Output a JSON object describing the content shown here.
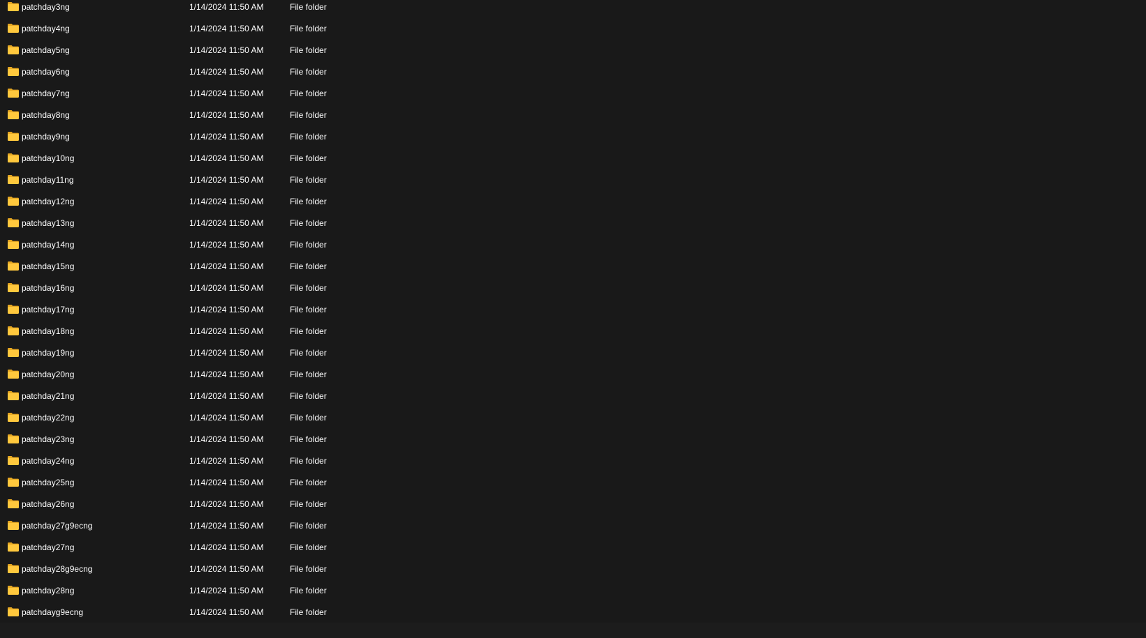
{
  "theme": {
    "background": "#191919",
    "text": "#ffffff",
    "folder_icon_color": "#ffc83d",
    "folder_icon_shade": "#e6a823"
  },
  "rows": [
    {
      "name": "patchday3ng",
      "date": "1/14/2024 11:50 AM",
      "type": "File folder",
      "icon": "folder-icon"
    },
    {
      "name": "patchday4ng",
      "date": "1/14/2024 11:50 AM",
      "type": "File folder",
      "icon": "folder-icon"
    },
    {
      "name": "patchday5ng",
      "date": "1/14/2024 11:50 AM",
      "type": "File folder",
      "icon": "folder-icon"
    },
    {
      "name": "patchday6ng",
      "date": "1/14/2024 11:50 AM",
      "type": "File folder",
      "icon": "folder-icon"
    },
    {
      "name": "patchday7ng",
      "date": "1/14/2024 11:50 AM",
      "type": "File folder",
      "icon": "folder-icon"
    },
    {
      "name": "patchday8ng",
      "date": "1/14/2024 11:50 AM",
      "type": "File folder",
      "icon": "folder-icon"
    },
    {
      "name": "patchday9ng",
      "date": "1/14/2024 11:50 AM",
      "type": "File folder",
      "icon": "folder-icon"
    },
    {
      "name": "patchday10ng",
      "date": "1/14/2024 11:50 AM",
      "type": "File folder",
      "icon": "folder-icon"
    },
    {
      "name": "patchday11ng",
      "date": "1/14/2024 11:50 AM",
      "type": "File folder",
      "icon": "folder-icon"
    },
    {
      "name": "patchday12ng",
      "date": "1/14/2024 11:50 AM",
      "type": "File folder",
      "icon": "folder-icon"
    },
    {
      "name": "patchday13ng",
      "date": "1/14/2024 11:50 AM",
      "type": "File folder",
      "icon": "folder-icon"
    },
    {
      "name": "patchday14ng",
      "date": "1/14/2024 11:50 AM",
      "type": "File folder",
      "icon": "folder-icon"
    },
    {
      "name": "patchday15ng",
      "date": "1/14/2024 11:50 AM",
      "type": "File folder",
      "icon": "folder-icon"
    },
    {
      "name": "patchday16ng",
      "date": "1/14/2024 11:50 AM",
      "type": "File folder",
      "icon": "folder-icon"
    },
    {
      "name": "patchday17ng",
      "date": "1/14/2024 11:50 AM",
      "type": "File folder",
      "icon": "folder-icon"
    },
    {
      "name": "patchday18ng",
      "date": "1/14/2024 11:50 AM",
      "type": "File folder",
      "icon": "folder-icon"
    },
    {
      "name": "patchday19ng",
      "date": "1/14/2024 11:50 AM",
      "type": "File folder",
      "icon": "folder-icon"
    },
    {
      "name": "patchday20ng",
      "date": "1/14/2024 11:50 AM",
      "type": "File folder",
      "icon": "folder-icon"
    },
    {
      "name": "patchday21ng",
      "date": "1/14/2024 11:50 AM",
      "type": "File folder",
      "icon": "folder-icon"
    },
    {
      "name": "patchday22ng",
      "date": "1/14/2024 11:50 AM",
      "type": "File folder",
      "icon": "folder-icon"
    },
    {
      "name": "patchday23ng",
      "date": "1/14/2024 11:50 AM",
      "type": "File folder",
      "icon": "folder-icon"
    },
    {
      "name": "patchday24ng",
      "date": "1/14/2024 11:50 AM",
      "type": "File folder",
      "icon": "folder-icon"
    },
    {
      "name": "patchday25ng",
      "date": "1/14/2024 11:50 AM",
      "type": "File folder",
      "icon": "folder-icon"
    },
    {
      "name": "patchday26ng",
      "date": "1/14/2024 11:50 AM",
      "type": "File folder",
      "icon": "folder-icon"
    },
    {
      "name": "patchday27g9ecng",
      "date": "1/14/2024 11:50 AM",
      "type": "File folder",
      "icon": "folder-icon"
    },
    {
      "name": "patchday27ng",
      "date": "1/14/2024 11:50 AM",
      "type": "File folder",
      "icon": "folder-icon"
    },
    {
      "name": "patchday28g9ecng",
      "date": "1/14/2024 11:50 AM",
      "type": "File folder",
      "icon": "folder-icon"
    },
    {
      "name": "patchday28ng",
      "date": "1/14/2024 11:50 AM",
      "type": "File folder",
      "icon": "folder-icon"
    },
    {
      "name": "patchdayg9ecng",
      "date": "1/14/2024 11:50 AM",
      "type": "File folder",
      "icon": "folder-icon"
    }
  ]
}
